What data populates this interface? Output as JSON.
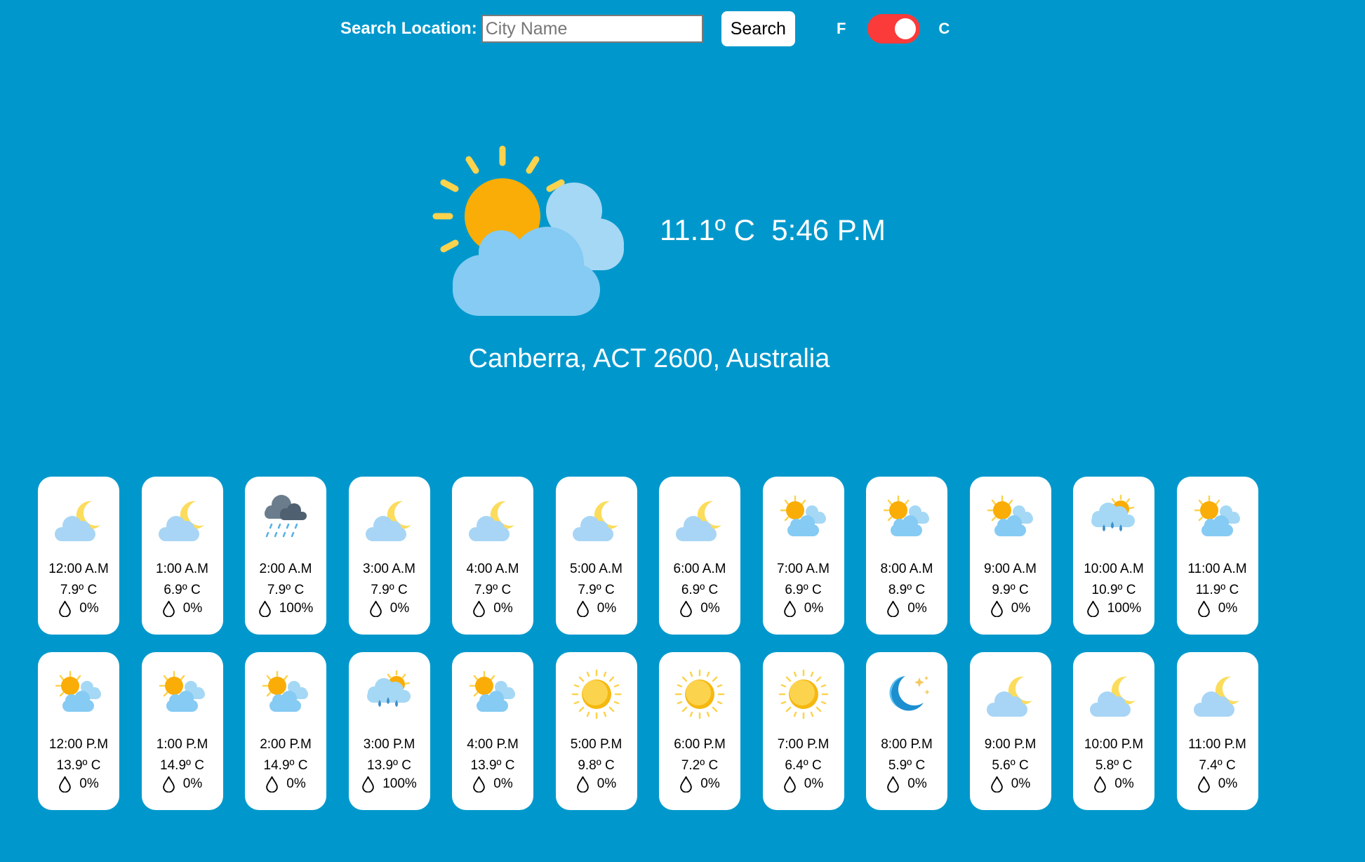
{
  "search": {
    "label": "Search Location:",
    "placeholder": "City Name",
    "value": "",
    "button_label": "Search"
  },
  "units": {
    "left_label": "F",
    "right_label": "C",
    "selected": "C"
  },
  "current": {
    "icon": "partly-cloudy-day-icon",
    "reading": "11.1º C  5:46 P.M",
    "location": "Canberra, ACT 2600, Australia"
  },
  "hourly": [
    {
      "time": "12:00 A.M",
      "temp": "7.9º C",
      "precip": "0%",
      "icon": "cloudy-night-icon"
    },
    {
      "time": "1:00 A.M",
      "temp": "6.9º C",
      "precip": "0%",
      "icon": "cloudy-night-icon"
    },
    {
      "time": "2:00 A.M",
      "temp": "7.9º C",
      "precip": "100%",
      "icon": "rain-icon"
    },
    {
      "time": "3:00 A.M",
      "temp": "7.9º C",
      "precip": "0%",
      "icon": "cloudy-night-icon"
    },
    {
      "time": "4:00 A.M",
      "temp": "7.9º C",
      "precip": "0%",
      "icon": "cloudy-night-icon"
    },
    {
      "time": "5:00 A.M",
      "temp": "7.9º C",
      "precip": "0%",
      "icon": "cloudy-night-icon"
    },
    {
      "time": "6:00 A.M",
      "temp": "6.9º C",
      "precip": "0%",
      "icon": "cloudy-night-icon"
    },
    {
      "time": "7:00 A.M",
      "temp": "6.9º C",
      "precip": "0%",
      "icon": "partly-cloudy-day-icon"
    },
    {
      "time": "8:00 A.M",
      "temp": "8.9º C",
      "precip": "0%",
      "icon": "partly-cloudy-day-icon"
    },
    {
      "time": "9:00 A.M",
      "temp": "9.9º C",
      "precip": "0%",
      "icon": "partly-cloudy-day-icon"
    },
    {
      "time": "10:00 A.M",
      "temp": "10.9º C",
      "precip": "100%",
      "icon": "sun-rain-icon"
    },
    {
      "time": "11:00 A.M",
      "temp": "11.9º C",
      "precip": "0%",
      "icon": "partly-cloudy-day-icon"
    },
    {
      "time": "12:00 P.M",
      "temp": "13.9º C",
      "precip": "0%",
      "icon": "partly-cloudy-day-icon"
    },
    {
      "time": "1:00 P.M",
      "temp": "14.9º C",
      "precip": "0%",
      "icon": "partly-cloudy-day-icon"
    },
    {
      "time": "2:00 P.M",
      "temp": "14.9º C",
      "precip": "0%",
      "icon": "partly-cloudy-day-icon"
    },
    {
      "time": "3:00 P.M",
      "temp": "13.9º C",
      "precip": "100%",
      "icon": "sun-rain-icon"
    },
    {
      "time": "4:00 P.M",
      "temp": "13.9º C",
      "precip": "0%",
      "icon": "partly-cloudy-day-icon"
    },
    {
      "time": "5:00 P.M",
      "temp": "9.8º C",
      "precip": "0%",
      "icon": "sunny-icon"
    },
    {
      "time": "6:00 P.M",
      "temp": "7.2º C",
      "precip": "0%",
      "icon": "sunny-icon"
    },
    {
      "time": "7:00 P.M",
      "temp": "6.4º C",
      "precip": "0%",
      "icon": "sunny-icon"
    },
    {
      "time": "8:00 P.M",
      "temp": "5.9º C",
      "precip": "0%",
      "icon": "clear-night-icon"
    },
    {
      "time": "9:00 P.M",
      "temp": "5.6º C",
      "precip": "0%",
      "icon": "cloudy-night-icon"
    },
    {
      "time": "10:00 P.M",
      "temp": "5.8º C",
      "precip": "0%",
      "icon": "cloudy-night-icon"
    },
    {
      "time": "11:00 P.M",
      "temp": "7.4º C",
      "precip": "0%",
      "icon": "cloudy-night-icon"
    }
  ]
}
